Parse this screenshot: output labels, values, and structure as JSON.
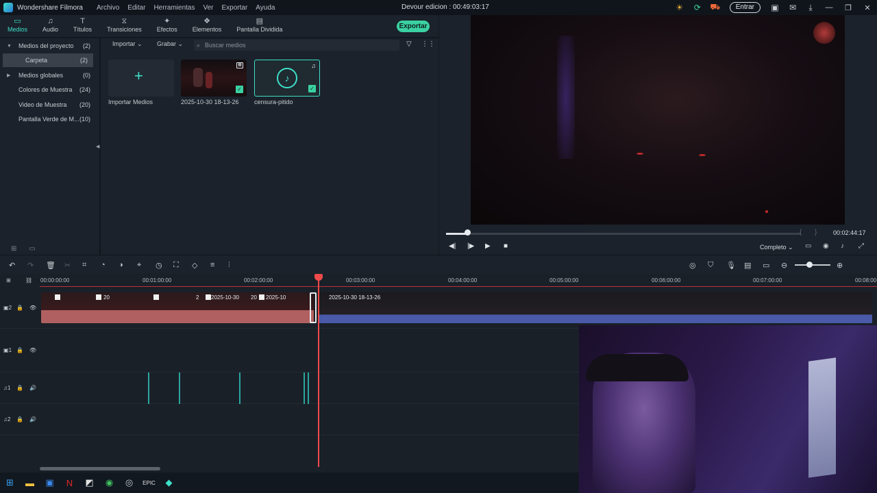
{
  "titlebar": {
    "app_name": "Wondershare Filmora",
    "menu": [
      "Archivo",
      "Editar",
      "Herramientas",
      "Ver",
      "Exportar",
      "Ayuda"
    ],
    "document_title": "Devour edicion : 00:49:03:17",
    "login_label": "Entrar",
    "icons": [
      "sun-icon",
      "sync-icon",
      "cart-icon",
      "save-icon",
      "mail-icon",
      "download-icon"
    ]
  },
  "media_tabs": [
    {
      "label": "Medios",
      "icon": "folder-icon"
    },
    {
      "label": "Audio",
      "icon": "music-icon"
    },
    {
      "label": "Títulos",
      "icon": "text-icon"
    },
    {
      "label": "Transiciones",
      "icon": "transition-icon"
    },
    {
      "label": "Efectos",
      "icon": "effects-icon"
    },
    {
      "label": "Elementos",
      "icon": "elements-icon"
    },
    {
      "label": "Pantalla Dividida",
      "icon": "split-screen-icon"
    }
  ],
  "export_label": "Exportar",
  "sidebar": {
    "items": [
      {
        "label": "Medios del proyecto",
        "count": "(2)"
      },
      {
        "label": "Carpeta",
        "count": "(2)"
      },
      {
        "label": "Medios globales",
        "count": "(0)"
      },
      {
        "label": "Colores de Muestra",
        "count": "(24)"
      },
      {
        "label": "Video de Muestra",
        "count": "(20)"
      },
      {
        "label": "Pantalla Verde de M...",
        "count": "(10)"
      }
    ]
  },
  "media_toolbar": {
    "import_label": "Importar",
    "record_label": "Grabar",
    "search_placeholder": "Buscar medios"
  },
  "media_items": [
    {
      "label": "Importar Medios",
      "kind": "import"
    },
    {
      "label": "2025-10-30 18-13-26",
      "kind": "video"
    },
    {
      "label": "censura-pitido",
      "kind": "audio"
    }
  ],
  "preview": {
    "total_time": "00:02:44:17",
    "progress": 0.06,
    "quality": "Completo"
  },
  "timeline": {
    "ruler": [
      "00:00:00:00",
      "00:01:00:00",
      "00:02:00:00",
      "00:03:00:00",
      "00:04:00:00",
      "00:05:00:00",
      "00:06:00:00",
      "00:07:00:00",
      "00:08:00"
    ],
    "video_clip_labels": [
      "20",
      "2",
      "2025-10-30",
      "20",
      "2025-10",
      "2025-10-30 18-13-26"
    ],
    "track_names": [
      "2",
      "1",
      "1",
      "2"
    ]
  },
  "colors": {
    "accent": "#3ee0c9",
    "export": "#3bd1a2",
    "playhead": "#f04a4a",
    "clip_audio_left": "#b06060",
    "clip_audio_right": "#4a5aa8"
  }
}
